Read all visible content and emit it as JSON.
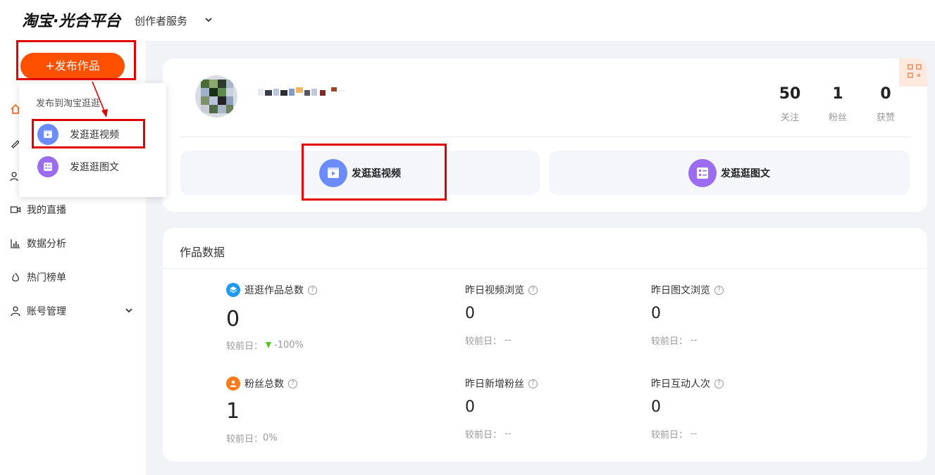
{
  "header": {
    "logo": "淘宝·光合平台",
    "service_menu": "创作者服务"
  },
  "sidebar": {
    "publish_button": "+发布作品",
    "items": [
      {
        "label": "我的直播",
        "icon": "video-camera-icon"
      },
      {
        "label": "数据分析",
        "icon": "bar-chart-icon"
      },
      {
        "label": "热门榜单",
        "icon": "flame-icon"
      },
      {
        "label": "账号管理",
        "icon": "user-icon"
      }
    ]
  },
  "dropdown": {
    "title": "发布到淘宝逛逛",
    "items": [
      {
        "label": "发逛逛视频",
        "icon": "play-video-icon",
        "color": "#6b8cff"
      },
      {
        "label": "发逛逛图文",
        "icon": "list-document-icon",
        "color": "#9b6bf0"
      }
    ]
  },
  "profile": {
    "stats": [
      {
        "value": "50",
        "label": "关注"
      },
      {
        "value": "1",
        "label": "粉丝"
      },
      {
        "value": "0",
        "label": "获赞"
      }
    ],
    "actions": [
      {
        "label": "发逛逛视频",
        "icon": "play-video-icon",
        "color": "#6b8cff"
      },
      {
        "label": "发逛逛图文",
        "icon": "list-document-icon",
        "color": "#9b6bf0"
      }
    ]
  },
  "works": {
    "title": "作品数据",
    "metrics": [
      {
        "label": "逛逛作品总数",
        "value": "0",
        "compare_prefix": "较前日：",
        "compare_value": "-100%",
        "icon": "layers-icon",
        "color": "#1e9bf0"
      },
      {
        "label": "昨日视频浏览",
        "value": "0",
        "compare_prefix": "较前日：",
        "compare_value": "--"
      },
      {
        "label": "昨日图文浏览",
        "value": "0",
        "compare_prefix": "较前日：",
        "compare_value": "--"
      },
      {
        "label": "粉丝总数",
        "value": "1",
        "compare_prefix": "较前日：",
        "compare_value": "0%",
        "icon": "fan-user-icon",
        "color": "#ff7a1a"
      },
      {
        "label": "昨日新增粉丝",
        "value": "0",
        "compare_prefix": "较前日：",
        "compare_value": "--"
      },
      {
        "label": "昨日互动人次",
        "value": "0",
        "compare_prefix": "较前日：",
        "compare_value": "--"
      }
    ]
  },
  "colors": {
    "brand_orange": "#ff5000",
    "annotation_red": "#e00000",
    "down_green": "#52c41a"
  }
}
